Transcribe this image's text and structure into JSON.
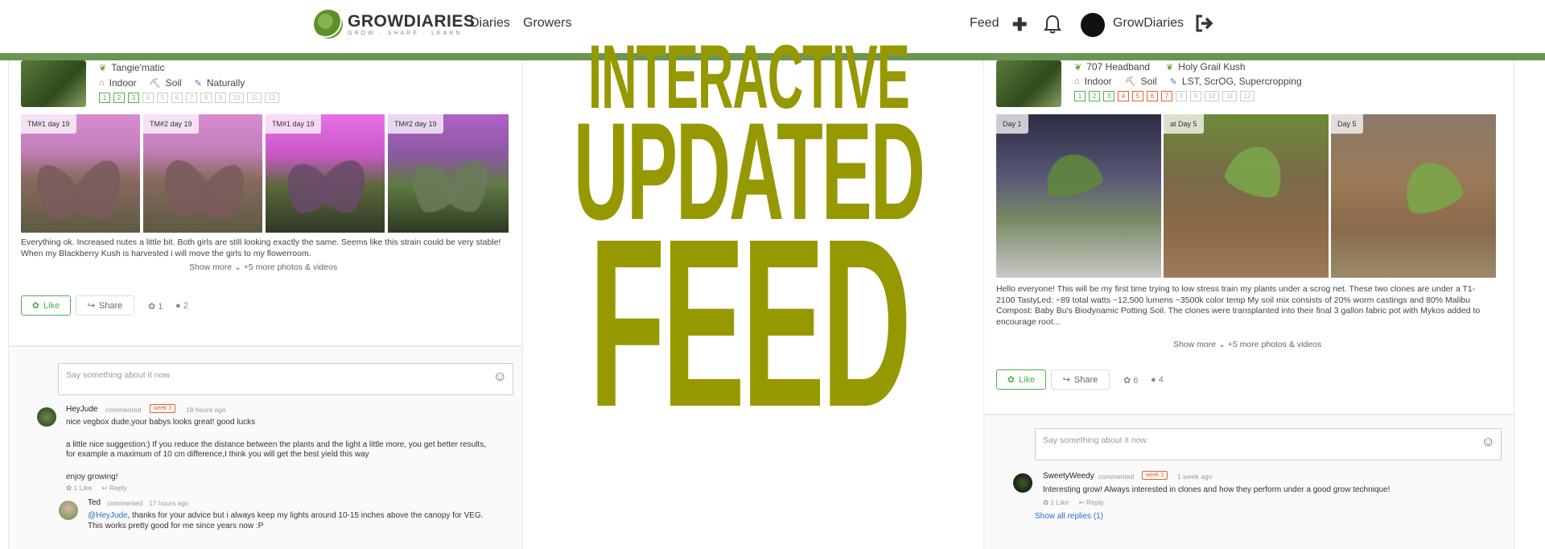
{
  "header": {
    "logo_name": "GROWDIARIES",
    "logo_tag": "GROW · SHARE · LEARN",
    "nav": [
      "Diaries",
      "Growers"
    ],
    "feed_label": "Feed",
    "user_name": "GrowDiaries"
  },
  "headline": {
    "line1": "INTERACTIVE",
    "line2": "UPDATED",
    "line3": "FEED"
  },
  "left_post": {
    "strain": "Tangie'matic",
    "room": "Indoor",
    "medium": "Soil",
    "nutrients": "Naturally",
    "weeks": [
      "1",
      "2",
      "3",
      "4",
      "5",
      "6",
      "7",
      "8",
      "9",
      "10",
      "11",
      "12"
    ],
    "photos": [
      {
        "caption": "TM#1 day 19"
      },
      {
        "caption": "TM#2 day 19"
      },
      {
        "caption": "TM#1 day 19"
      },
      {
        "caption": "TM#2 day 19"
      }
    ],
    "text_line1": "Everything ok. Increased nutes a little bit. Both girls are still looking exactly the same. Seems like this strain could be very stable!",
    "text_line2": "When my Blackberry Kush is harvested i will move the girls to my flowerroom.",
    "show_more": "Show more",
    "more_media": "+5 more photos & videos",
    "like_label": "Like",
    "share_label": "Share",
    "likes": "1",
    "comments": "2",
    "comment_placeholder": "Say something about it now",
    "comment1": {
      "author": "HeyJude",
      "action": "commented",
      "week": "week 3",
      "time": "18 hours ago",
      "line1": "nice vegbox dude,your babys looks great! good lucks",
      "line2": "a little nice suggestion:) If you reduce the distance between the plants and the light a little more, you get better results,",
      "line3": "for example a maximum of 10 cm difference,I think you will get the best yield this way",
      "line4": "enjoy growing!",
      "likes": "1 Like",
      "reply": "Reply"
    },
    "comment2": {
      "author": "Ted",
      "action": "commented",
      "time": "17 hours ago",
      "mention": "@HeyJude",
      "line1": ", thanks for your advice but i always keep my lights around 10-15 inches above the canopy for VEG.",
      "line2": "This works pretty good for me since years now :P"
    }
  },
  "right_post": {
    "strain1": "707 Headband",
    "strain2": "Holy Grail Kush",
    "room": "Indoor",
    "medium": "Soil",
    "technique": "LST, ScrOG, Supercropping",
    "weeks": [
      "1",
      "2",
      "3",
      "4",
      "5",
      "6",
      "7",
      "8",
      "9",
      "10",
      "11",
      "12"
    ],
    "photos": [
      {
        "caption": "Day 1"
      },
      {
        "caption": "at Day 5"
      },
      {
        "caption": "Day 5"
      }
    ],
    "text_line1": "Hello everyone! This will be my first time trying to low stress train my plants under a scrog net. These two clones are under a T1-",
    "text_line2": "2100 TastyLed: ~89 total watts ~12,500 lumens ~3500k color temp My soil mix consists of 20% worm castings and 80% Malibu",
    "text_line3": "Compost: Baby Bu's Biodynamic Potting Soil. The clones were transplanted into their final 3 gallon fabric pot with Mykos added to",
    "text_line4": "encourage root...",
    "show_more": "Show more",
    "more_media": "+5 more photos & videos",
    "like_label": "Like",
    "share_label": "Share",
    "likes": "6",
    "comments": "4",
    "comment_placeholder": "Say something about it now",
    "comment1": {
      "author": "SweetyWeedy",
      "action": "commented",
      "week": "week 1",
      "time": "1 week ago",
      "line1": "Interesting grow! Always interested in clones and how they perform under a good grow technique!",
      "likes": "1 Like",
      "reply": "Reply"
    },
    "show_replies": "Show all replies (1)"
  },
  "colors": {
    "brand_green": "#6a9552",
    "headline": "#969800",
    "week_orange": "#e8602c",
    "link": "#2a6bd6"
  }
}
